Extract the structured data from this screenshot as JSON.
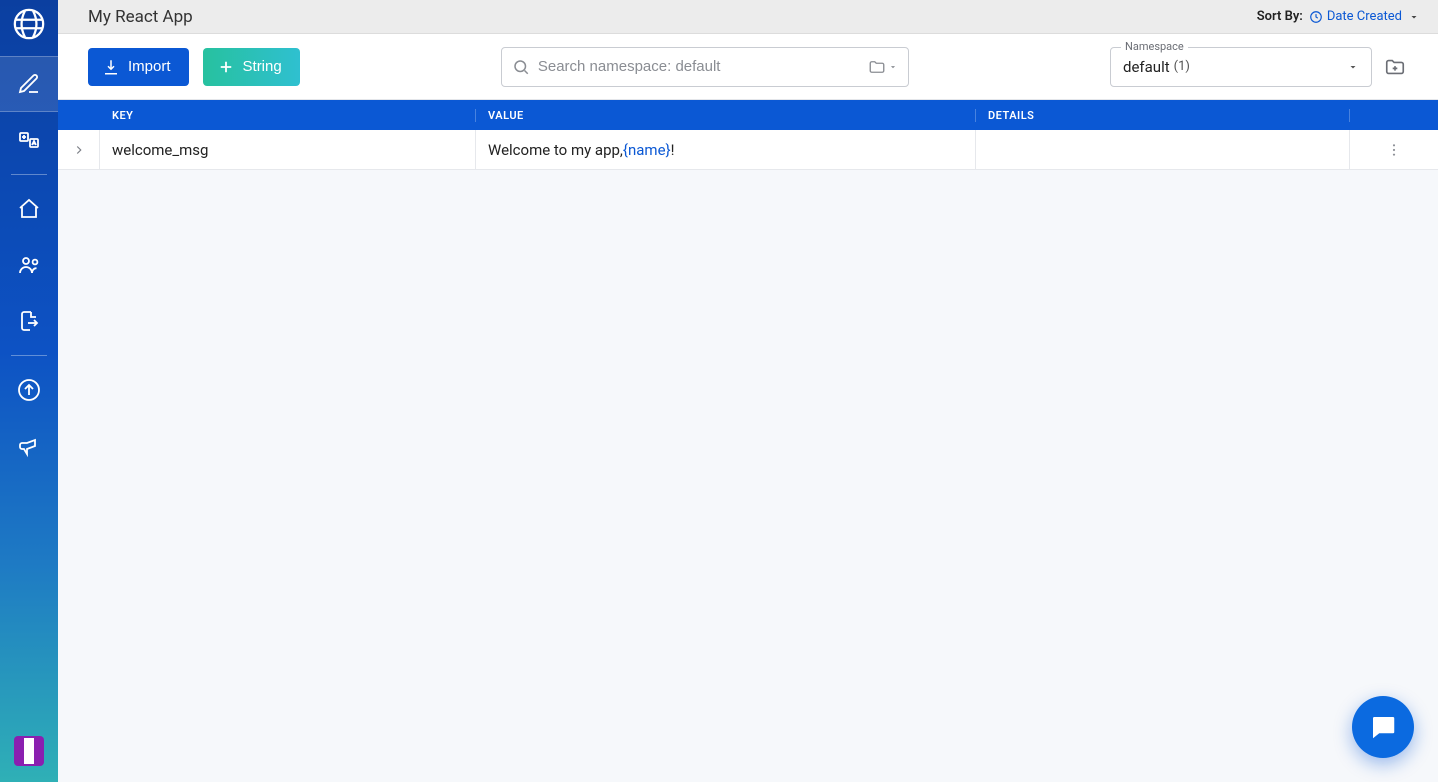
{
  "header": {
    "app_title": "My React App",
    "sort_by_label": "Sort By:",
    "sort_by_value": "Date Created"
  },
  "toolbar": {
    "import_label": "Import",
    "string_label": "String",
    "search_placeholder": "Search namespace: default",
    "namespace_label": "Namespace",
    "namespace_value": "default",
    "namespace_count": "(1)"
  },
  "table": {
    "headers": {
      "key": "KEY",
      "value": "VALUE",
      "details": "DETAILS"
    },
    "rows": [
      {
        "key": "welcome_msg",
        "value_prefix": "Welcome to my app, ",
        "value_token": "{name}",
        "value_suffix": "!",
        "details": ""
      }
    ]
  },
  "sidebar": {
    "items": [
      {
        "name": "edit",
        "selected": true
      },
      {
        "name": "translate",
        "selected": false
      },
      {
        "name": "home",
        "selected": false
      },
      {
        "name": "team",
        "selected": false
      },
      {
        "name": "export",
        "selected": false
      },
      {
        "name": "upload",
        "selected": false
      },
      {
        "name": "announce",
        "selected": false
      }
    ]
  }
}
